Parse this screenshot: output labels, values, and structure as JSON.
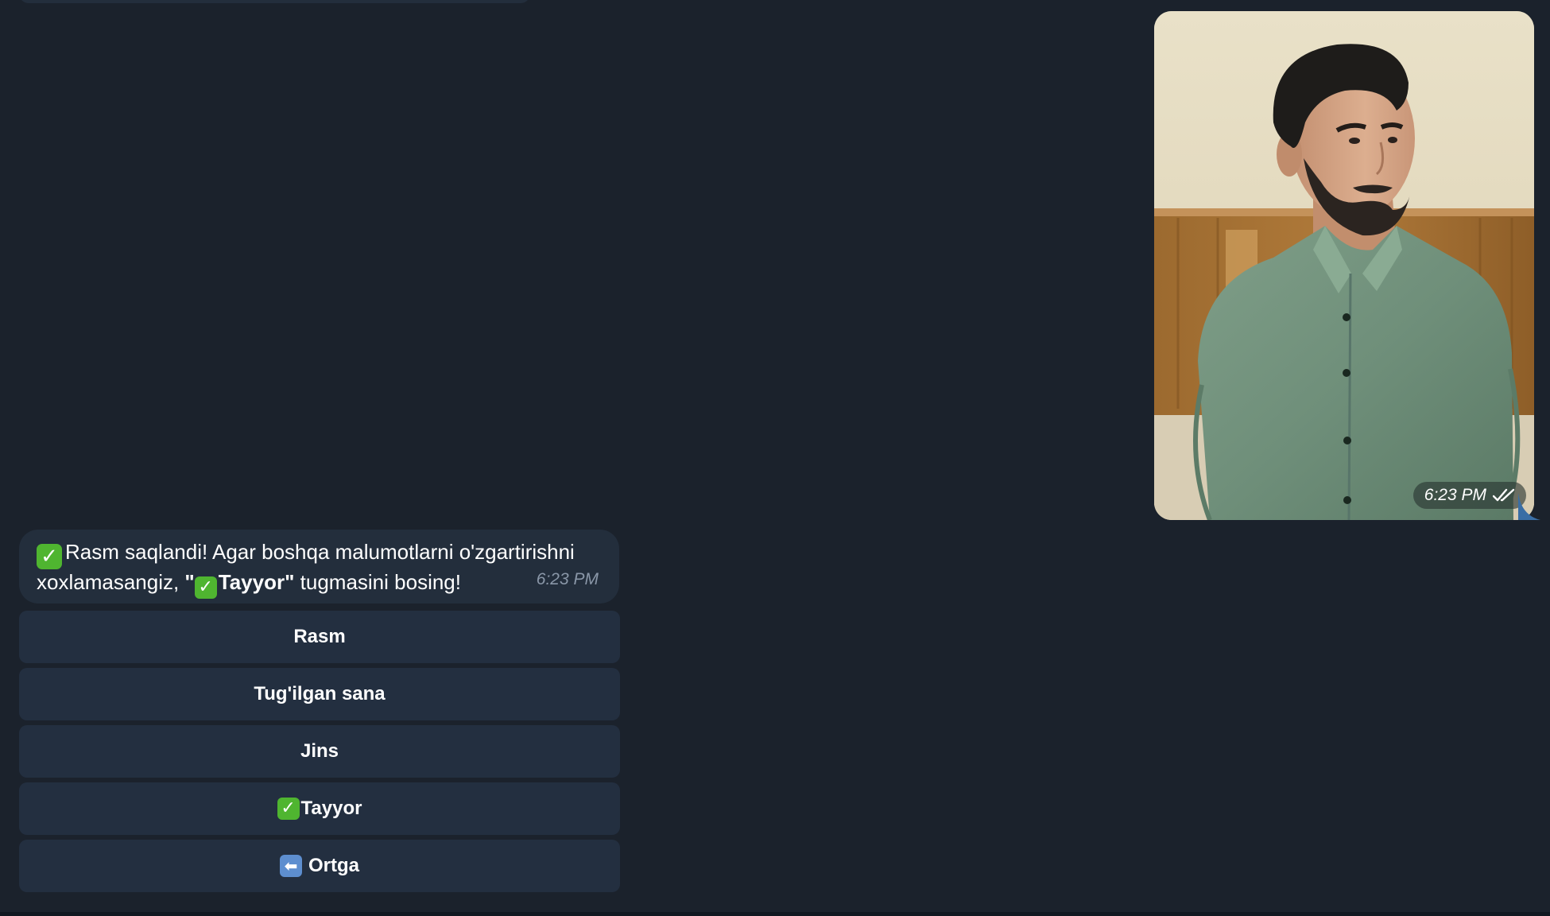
{
  "incoming_message": {
    "line1_text": "Rasm saqlandi! Agar boshqa malumotlarni o'zgartirishni",
    "line2_prefix": "xoxlamasangiz, ",
    "line2_bold": "\"✅Tayyor\"",
    "line2_suffix": " tugmasini bosing!",
    "time": "6:23 PM"
  },
  "outgoing_photo": {
    "time": "6:23 PM",
    "status_icon": "double-check-icon"
  },
  "keyboard": {
    "buttons": [
      {
        "label": "Rasm"
      },
      {
        "label": "Tug'ilgan sana"
      },
      {
        "label": "Jins"
      },
      {
        "label": "Tayyor",
        "icon": "check-emoji-icon"
      },
      {
        "label": "Ortga",
        "icon": "back-arrow-emoji-icon"
      }
    ]
  },
  "colors": {
    "background": "#1b222c",
    "bubble": "#232e3c",
    "button": "#232f40",
    "time_text": "#8a97a8",
    "check_emoji": "#4fb530",
    "back_emoji": "#5d8ecf"
  }
}
